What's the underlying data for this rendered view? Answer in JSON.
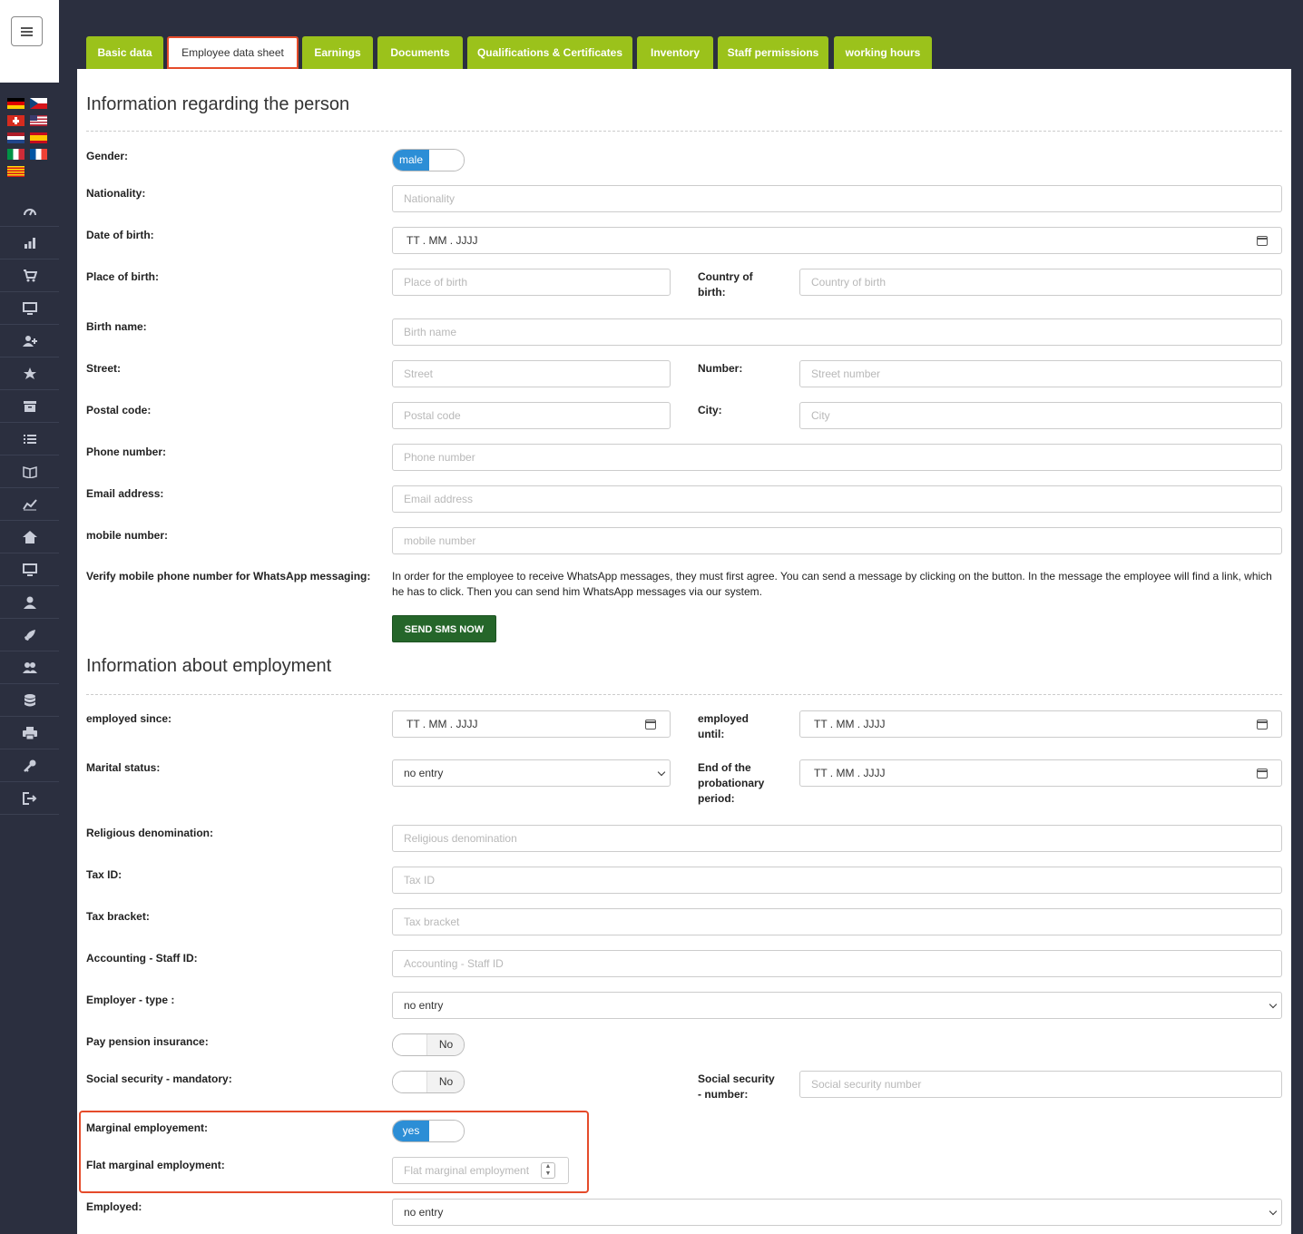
{
  "tabs": [
    "Basic data",
    "Employee data sheet",
    "Earnings",
    "Documents",
    "Qualifications & Certificates",
    "Inventory",
    "Staff permissions",
    "working hours"
  ],
  "active_tab": "Employee data sheet",
  "sections": {
    "person": "Information regarding the person",
    "employment": "Information about employment"
  },
  "labels": {
    "gender": "Gender:",
    "nationality": "Nationality:",
    "dob": "Date of birth:",
    "place_of_birth": "Place of birth:",
    "country_of_birth_1": "Country of",
    "country_of_birth_2": "birth:",
    "birth_name": "Birth name:",
    "street": "Street:",
    "number": "Number:",
    "postal_code": "Postal code:",
    "city": "City:",
    "phone": "Phone number:",
    "email": "Email address:",
    "mobile": "mobile number:",
    "verify": "Verify mobile phone number for WhatsApp messaging:",
    "employed_since": "employed since:",
    "employed_until_1": "employed",
    "employed_until_2": "until:",
    "marital": "Marital status:",
    "probation_1": "End of the",
    "probation_2": "probationary",
    "probation_3": "period:",
    "religion": "Religious denomination:",
    "tax_id": "Tax ID:",
    "tax_bracket": "Tax bracket:",
    "accounting": "Accounting - Staff ID:",
    "employer_type": "Employer - type :",
    "pension": "Pay pension insurance:",
    "social_mandatory": "Social security - mandatory:",
    "social_number_1": "Social security",
    "social_number_2": "- number:",
    "marginal": "Marginal employement:",
    "flat_marginal": "Flat marginal employment:",
    "employed": "Employed:"
  },
  "placeholders": {
    "nationality": "Nationality",
    "place_of_birth": "Place of birth",
    "country_of_birth": "Country of birth",
    "birth_name": "Birth name",
    "street": "Street",
    "street_number": "Street number",
    "postal_code": "Postal code",
    "city": "City",
    "phone": "Phone number",
    "email": "Email address",
    "mobile": "mobile number",
    "religion": "Religious denomination",
    "tax_id": "Tax ID",
    "tax_bracket": "Tax bracket",
    "accounting": "Accounting - Staff ID",
    "social_number": "Social security number",
    "flat_marginal": "Flat marginal employment"
  },
  "values": {
    "gender": "male",
    "date_format": "TT . MM . JJJJ",
    "marital": "no entry",
    "employer_type": "no entry",
    "pension": "No",
    "social_mandatory": "No",
    "marginal": "yes",
    "employed": "no entry"
  },
  "whatsapp_text": "In order for the employee to receive WhatsApp messages, they must first agree. You can send a message by clicking on the button. In the message the employee will find a link, which he has to click. Then you can send him WhatsApp messages via our system.",
  "sms_button": "SEND SMS NOW",
  "sidebar_icons": [
    "gauge-icon",
    "bar-chart-icon",
    "cart-icon",
    "monitor-icon",
    "add-user-icon",
    "star-icon",
    "archive-icon",
    "list-icon",
    "book-icon",
    "line-chart-icon",
    "home-icon",
    "monitor-icon",
    "user-icon",
    "rocket-icon",
    "users-icon",
    "database-icon",
    "print-icon",
    "key-icon",
    "logout-icon"
  ],
  "flags": [
    "de",
    "cz",
    "ch",
    "us",
    "nl",
    "es",
    "it",
    "fr",
    "ca"
  ],
  "colors": {
    "tab_green": "#9bc21b",
    "highlight": "#e54b2a",
    "toggle_blue": "#2c8ed6",
    "button_green": "#25662a",
    "sidebar": "#2b2f3f"
  }
}
